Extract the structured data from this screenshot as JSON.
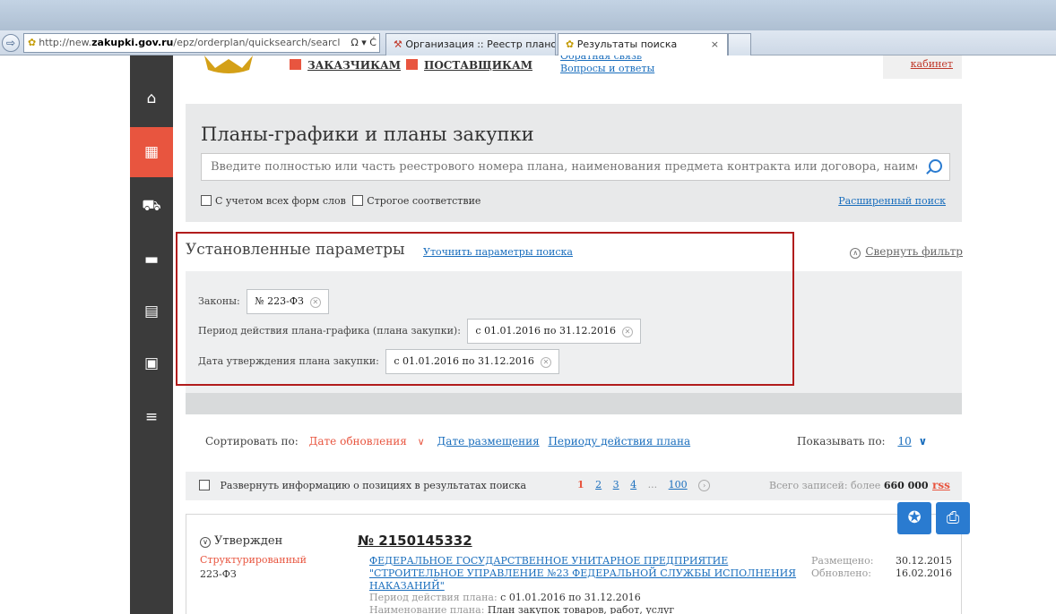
{
  "browser": {
    "address": "http://new.zakupki.gov.ru/epz/orderplan/quicksearch/searcl",
    "address_prefix": "http://new.",
    "address_domain": "zakupki.gov.ru",
    "address_path": "/epz/orderplan/quicksearch/searcl",
    "address_controls": "Ω ▾ Ć",
    "tabs": [
      {
        "label": "Организация :: Реестр плано...",
        "active": false
      },
      {
        "label": "Результаты поиска",
        "active": true
      }
    ],
    "close_label": "×"
  },
  "header": {
    "customers_label": "ЗАКАЗЧИКАМ",
    "suppliers_label": "ПОСТАВЩИКАМ",
    "feedback_label": "Обратная связь",
    "faq_label": "Вопросы и ответы",
    "cabinet_label": "кабинет"
  },
  "search": {
    "title": "Планы-графики и планы закупки",
    "placeholder": "Введите полностью или часть реестрового номера плана, наименования предмета контракта или договора, наиме",
    "all_forms_label": "С учетом всех форм слов",
    "strict_label": "Строгое соответствие",
    "advanced_label": "Расширенный поиск"
  },
  "params": {
    "title": "Установленные параметры",
    "refine_label": "Уточнить параметры поиска",
    "collapse_label": "Свернуть фильтр",
    "laws_label": "Законы:",
    "laws_value": "№ 223-ФЗ",
    "period_label": "Период действия плана-графика (плана закупки):",
    "period_value": "с 01.01.2016 по 31.12.2016",
    "approval_label": "Дата утверждения плана закупки:",
    "approval_value": "с 01.01.2016 по 31.12.2016"
  },
  "sort": {
    "label": "Сортировать по:",
    "active": "Дате обновления",
    "option_placement": "Дате размещения",
    "option_period": "Периоду действия плана",
    "show_by_label": "Показывать по:",
    "show_by_value": "10"
  },
  "results_bar": {
    "expand_label": "Развернуть информацию о позициях в результатах поиска",
    "pages": [
      "1",
      "2",
      "3",
      "4",
      "...",
      "100"
    ],
    "total_label": "Всего записей: более",
    "total_value": "660 000",
    "rss_label": "rss"
  },
  "result": {
    "status": "Утвержден",
    "type": "Структурированный",
    "law": "223-ФЗ",
    "number": "№ 2150145332",
    "org_name": "ФЕДЕРАЛЬНОЕ ГОСУДАРСТВЕННОЕ УНИТАРНОЕ ПРЕДПРИЯТИЕ \"СТРОИТЕЛЬНОЕ УПРАВЛЕНИЕ №23 ФЕДЕРАЛЬНОЙ СЛУЖБЫ ИСПОЛНЕНИЯ НАКАЗАНИЙ\"",
    "placed_label": "Размещено:",
    "placed_value": "30.12.2015",
    "updated_label": "Обновлено:",
    "updated_value": "16.02.2016",
    "period_label": "Период действия плана:",
    "period_value": "с 01.01.2016 по 31.12.2016",
    "plan_name_label": "Наименование плана:",
    "plan_name_value": "План закупок товаров, работ, услуг"
  },
  "colors": {
    "accent": "#e8553f",
    "link": "#1a6ebd",
    "sidebar": "#3b3b3b",
    "highlight": "#b11c1c"
  }
}
